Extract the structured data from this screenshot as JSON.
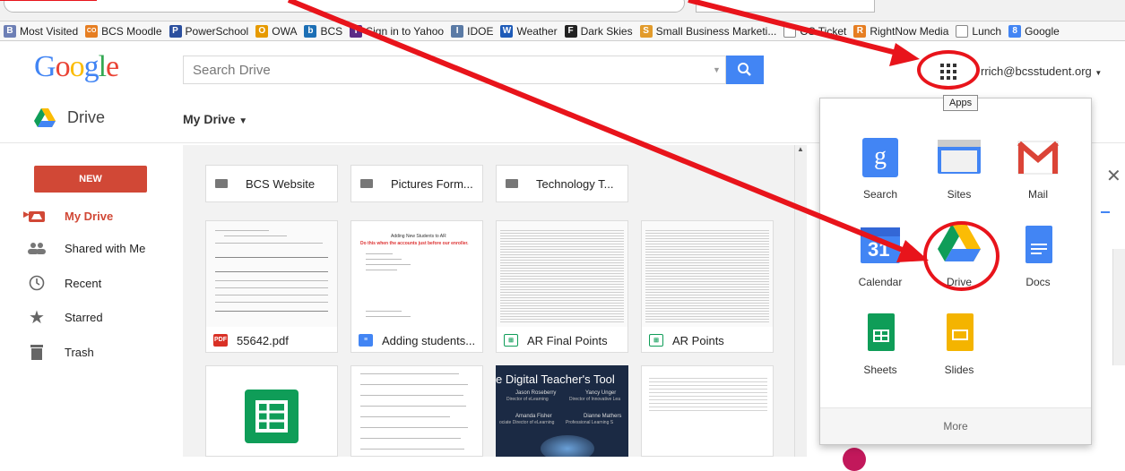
{
  "bookmarks": [
    {
      "label": "Most Visited",
      "color": "#6d7fb5",
      "glyph": "B"
    },
    {
      "label": "BCS Moodle",
      "color": "#e67e22",
      "glyph": "CO"
    },
    {
      "label": "PowerSchool",
      "color": "#2b4f9e",
      "glyph": "P"
    },
    {
      "label": "OWA",
      "color": "#e69a00",
      "glyph": "O"
    },
    {
      "label": "BCS",
      "color": "#1c6fb5",
      "glyph": "b"
    },
    {
      "label": "Sign in to Yahoo",
      "color": "#5b2a86",
      "glyph": "Y"
    },
    {
      "label": "IDOE",
      "color": "#5a7aa5",
      "glyph": "I"
    },
    {
      "label": "Weather",
      "color": "#1e5bb8",
      "glyph": "W"
    },
    {
      "label": "Dark Skies",
      "color": "#222222",
      "glyph": "F"
    },
    {
      "label": "Small Business Marketi...",
      "color": "#e29b2b",
      "glyph": "S"
    },
    {
      "label": "OS Ticket",
      "color": "#cccccc",
      "glyph": ""
    },
    {
      "label": "RightNow Media",
      "color": "#e67e22",
      "glyph": "R"
    },
    {
      "label": "Lunch",
      "color": "#cccccc",
      "glyph": ""
    },
    {
      "label": "Google",
      "color": "#4285f4",
      "glyph": "8"
    }
  ],
  "header": {
    "logo": "Google",
    "search_placeholder": "Search Drive",
    "account": "rrich@bcsstudent.org",
    "apps_tooltip": "Apps"
  },
  "toolbar": {
    "app_name": "Drive",
    "location": "My Drive"
  },
  "sidebar": {
    "new_label": "NEW",
    "items": [
      {
        "label": "My Drive",
        "icon": "drive-folder-icon",
        "active": true
      },
      {
        "label": "Shared with Me",
        "icon": "people-icon",
        "active": false
      },
      {
        "label": "Recent",
        "icon": "clock-icon",
        "active": false
      },
      {
        "label": "Starred",
        "icon": "star-icon",
        "active": false
      },
      {
        "label": "Trash",
        "icon": "trash-icon",
        "active": false
      }
    ]
  },
  "folders": [
    {
      "name": "BCS Website"
    },
    {
      "name": "Pictures Form..."
    },
    {
      "name": "Technology T..."
    }
  ],
  "files": [
    {
      "name": "55642.pdf",
      "type": "pdf",
      "tag": "PDF",
      "color": "#d93025"
    },
    {
      "name": "Adding students...",
      "type": "doc",
      "tag": "",
      "color": "#4285f4"
    },
    {
      "name": "AR Final Points",
      "type": "sheet",
      "tag": "",
      "color": "#0f9d58"
    },
    {
      "name": "AR Points",
      "type": "sheet",
      "tag": "",
      "color": "#0f9d58"
    }
  ],
  "thumbnails": {
    "adding_students_heading": "Adding New Students to AR",
    "adding_students_red": "Do this when the accounts just before our enroller.",
    "slides": {
      "title": "e Digital Teacher's Tool",
      "people": [
        {
          "name": "Jason Roseberry",
          "role": "Director of eLearning"
        },
        {
          "name": "Yancy Unger",
          "role": "Director of Innovative Lea"
        },
        {
          "name": "Amanda Fisher",
          "role": "ociate Director of eLearning"
        },
        {
          "name": "Dianne Mathers",
          "role": "Professional Learning S"
        }
      ]
    }
  },
  "apps_popup": {
    "apps": [
      {
        "label": "Search",
        "icon": "google-search-icon"
      },
      {
        "label": "Sites",
        "icon": "sites-icon"
      },
      {
        "label": "Mail",
        "icon": "gmail-icon"
      },
      {
        "label": "Calendar",
        "icon": "calendar-icon"
      },
      {
        "label": "Drive",
        "icon": "drive-icon"
      },
      {
        "label": "Docs",
        "icon": "docs-icon"
      },
      {
        "label": "Sheets",
        "icon": "sheets-icon"
      },
      {
        "label": "Slides",
        "icon": "slides-icon"
      }
    ],
    "more_label": "More"
  },
  "colors": {
    "accent_red": "#d14836",
    "blue": "#4285f4",
    "annotation_red": "#e8141b"
  }
}
